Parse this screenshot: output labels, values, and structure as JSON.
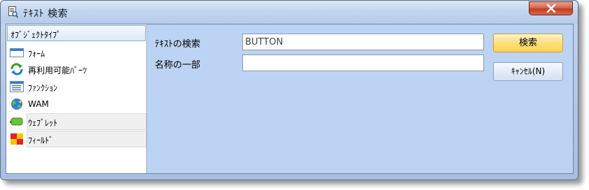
{
  "window": {
    "title": "ﾃｷｽﾄ 検索",
    "close_symbol": "✕"
  },
  "left_panel": {
    "header": "ｵﾌﾞｼﾞｪｸﾄﾀｲﾌﾟ",
    "items": [
      {
        "label": "ﾌｫｰﾑ",
        "icon": "form-icon"
      },
      {
        "label": "再利用可能ﾊﾟｰﾂ",
        "icon": "recycle-icon"
      },
      {
        "label": "ﾌｧﾝｸｼｮﾝ",
        "icon": "function-icon"
      },
      {
        "label": "WAM",
        "icon": "globe-icon"
      },
      {
        "label": "ｳｪﾌﾞﾚｯﾄ",
        "icon": "weblet-icon"
      },
      {
        "label": "ﾌｨｰﾙﾄﾞ",
        "icon": "field-icon"
      }
    ]
  },
  "form": {
    "text_search_label": "ﾃｷｽﾄの検索",
    "text_search_value": "BUTTON",
    "name_part_label": "名称の一部",
    "name_part_value": ""
  },
  "buttons": {
    "search": "検索",
    "cancel": "ｷｬﾝｾﾙ(N)"
  },
  "colors": {
    "search_button": "#ffdf7a",
    "client_background": "#bcd3f3",
    "close_button": "#c43a22"
  }
}
